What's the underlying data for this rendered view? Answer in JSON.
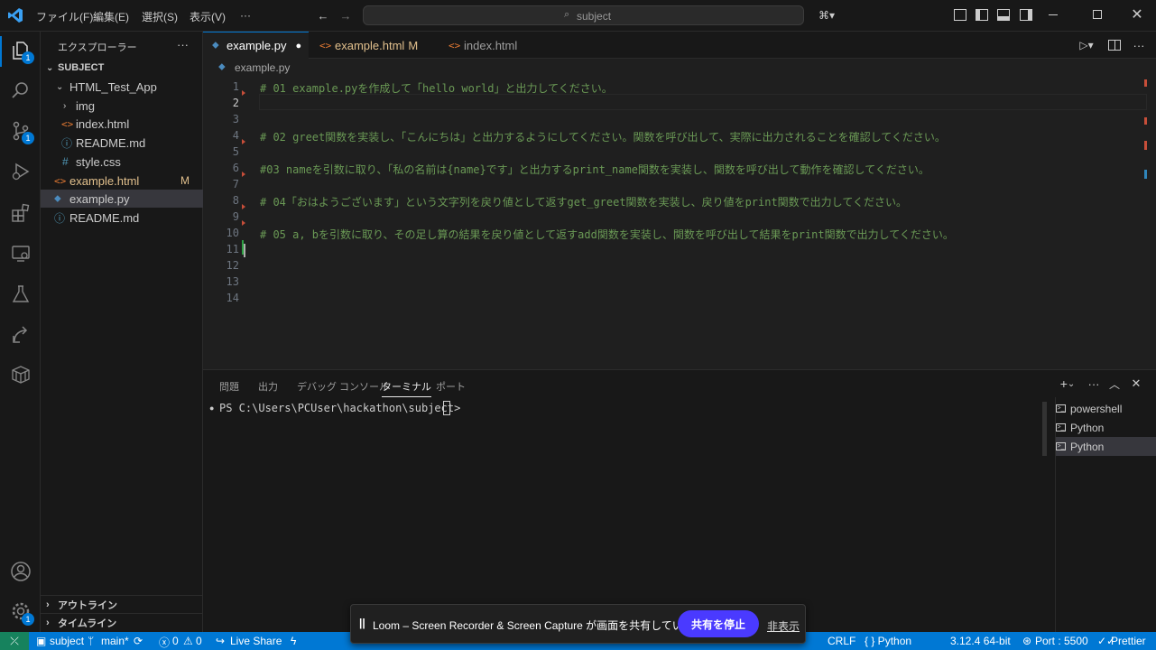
{
  "title_bar": {
    "menus": [
      "ファイル(F)",
      "編集(E)",
      "選択(S)",
      "表示(V)",
      "···"
    ],
    "search": "subject"
  },
  "activity_bar": {
    "explorer_badge": "1",
    "scm_badge": "1",
    "settings_badge": "1"
  },
  "sidebar": {
    "title": "エクスプローラー",
    "more": "···",
    "root": "SUBJECT",
    "items": [
      {
        "label": "HTML_Test_App",
        "badge": ""
      },
      {
        "label": "img",
        "badge": ""
      },
      {
        "label": "index.html",
        "badge": ""
      },
      {
        "label": "README.md",
        "badge": ""
      },
      {
        "label": "style.css",
        "badge": ""
      },
      {
        "label": "example.html",
        "badge": "M"
      },
      {
        "label": "example.py",
        "badge": ""
      },
      {
        "label": "README.md",
        "badge": ""
      }
    ],
    "outline": "アウトライン",
    "timeline": "タイムライン"
  },
  "tabs": [
    {
      "label": "example.py",
      "badge": "●"
    },
    {
      "label": "example.html",
      "badge": "M"
    },
    {
      "label": "index.html",
      "badge": ""
    }
  ],
  "breadcrumb": "example.py",
  "editor": {
    "lines": [
      {
        "n": "1",
        "text": "# 01 example.pyを作成して「hello world」と出力してください。"
      },
      {
        "n": "2",
        "text": ""
      },
      {
        "n": "3",
        "text": ""
      },
      {
        "n": "4",
        "text": "# 02 greet関数を実装し、「こんにちは」と出力するようにしてください。関数を呼び出して、実際に出力されることを確認してください。"
      },
      {
        "n": "5",
        "text": ""
      },
      {
        "n": "6",
        "text": "#03 nameを引数に取り、「私の名前は{name}です」と出力するprint_name関数を実装し、関数を呼び出して動作を確認してください。"
      },
      {
        "n": "7",
        "text": ""
      },
      {
        "n": "8",
        "text": "# 04「おはようございます」という文字列を戻り値として返すget_greet関数を実装し、戻り値をprint関数で出力してください。"
      },
      {
        "n": "9",
        "text": ""
      },
      {
        "n": "10",
        "text": "# 05 a, bを引数に取り、その足し算の結果を戻り値として返すadd関数を実装し、関数を呼び出して結果をprint関数で出力してください。"
      },
      {
        "n": "11",
        "text": ""
      },
      {
        "n": "12",
        "text": ""
      },
      {
        "n": "13",
        "text": ""
      },
      {
        "n": "14",
        "text": ""
      }
    ]
  },
  "panel": {
    "tabs": [
      "問題",
      "出力",
      "デバッグ コンソール",
      "ターミナル",
      "ポート"
    ],
    "prompt": "PS C:\\Users\\PCUser\\hackathon\\subject>",
    "terminals": [
      "powershell",
      "Python",
      "Python"
    ]
  },
  "status_bar": {
    "branch_folder": "subject",
    "branch": "main*",
    "errors": "0",
    "warnings": "0",
    "live_share": "Live Share",
    "encoding": "CRLF",
    "language": "{ } Python",
    "interpreter": "3.12.4 64-bit",
    "port": "Port : 5500",
    "prettier": "Prettier"
  },
  "share_banner": {
    "text": "Loom – Screen Recorder & Screen Capture が画面を共有しています。",
    "stop": "共有を停止",
    "hide": "非表示"
  },
  "colors": {
    "accent": "#0078d4",
    "comment": "#6a9955",
    "modified": "#e2c08d",
    "git_red": "#c74e39"
  }
}
